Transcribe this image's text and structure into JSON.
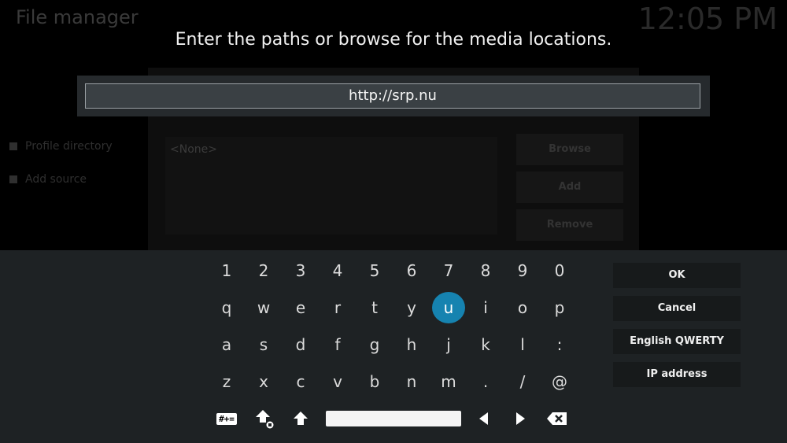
{
  "background": {
    "title": "File manager",
    "clock": "12:05 PM",
    "sidebar": [
      "Profile directory",
      "Add source"
    ],
    "list_item": "<None>",
    "buttons": [
      "Browse",
      "Add",
      "Remove"
    ]
  },
  "dialog": {
    "heading": "Enter the paths or browse for the media locations.",
    "input_value": "http://srp.nu"
  },
  "keyboard": {
    "rows": [
      [
        "1",
        "2",
        "3",
        "4",
        "5",
        "6",
        "7",
        "8",
        "9",
        "0"
      ],
      [
        "q",
        "w",
        "e",
        "r",
        "t",
        "y",
        "u",
        "i",
        "o",
        "p"
      ],
      [
        "a",
        "s",
        "d",
        "f",
        "g",
        "h",
        "j",
        "k",
        "l",
        ":"
      ],
      [
        "z",
        "x",
        "c",
        "v",
        "b",
        "n",
        "m",
        ".",
        "/",
        "@"
      ]
    ],
    "selected_key": "u",
    "symbols_label": "#+=",
    "side_buttons": [
      "OK",
      "Cancel",
      "English QWERTY",
      "IP address"
    ]
  },
  "colors": {
    "accent": "#1683b0",
    "panel": "#1e2224"
  }
}
